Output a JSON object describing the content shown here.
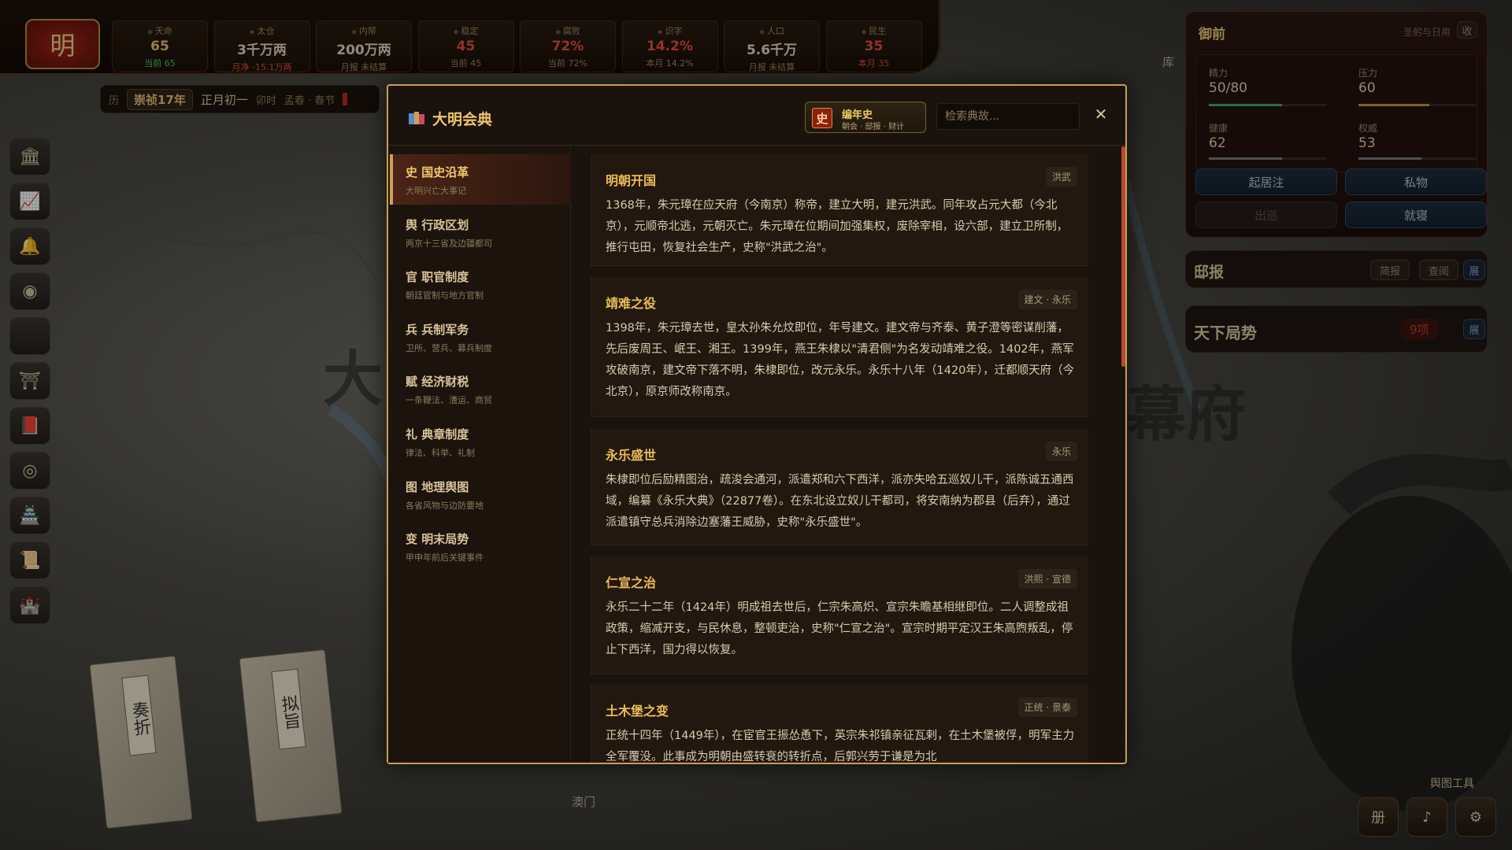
{
  "map": {
    "big_chars": [
      "大",
      "幕府"
    ],
    "small_labels": [
      "库",
      "澳门"
    ]
  },
  "topbar": {
    "emblem": "明",
    "stats": [
      {
        "name": "天命",
        "value": "65",
        "sub": "当前 65",
        "value_color": "#e6c46a",
        "sub_color": "#4ec46a"
      },
      {
        "name": "太仓",
        "value": "3千万两",
        "sub": "月净 -15.1万两",
        "value_color": "#e0d6c0",
        "sub_color": "#e0503a"
      },
      {
        "name": "内帑",
        "value": "200万两",
        "sub": "月报 未结算",
        "value_color": "#e0d6c0",
        "sub_color": "#9a8a6a"
      },
      {
        "name": "稳定",
        "value": "45",
        "sub": "当前 45",
        "value_color": "#e0503a",
        "sub_color": "#9a8a6a"
      },
      {
        "name": "腐败",
        "value": "72%",
        "sub": "当前 72%",
        "value_color": "#e0503a",
        "sub_color": "#9a8a6a"
      },
      {
        "name": "识字",
        "value": "14.2%",
        "sub": "本月 14.2%",
        "value_color": "#e0503a",
        "sub_color": "#9a8a6a"
      },
      {
        "name": "人口",
        "value": "5.6千万",
        "sub": "月报 未结算",
        "value_color": "#e0d6c0",
        "sub_color": "#9a8a6a"
      },
      {
        "name": "民生",
        "value": "35",
        "sub": "本月 35",
        "value_color": "#e0503a",
        "sub_color": "#e0503a"
      }
    ],
    "date": {
      "prefix": "历",
      "era": "崇祯17年",
      "month_day": "正月初一",
      "hour": "卯时",
      "season": "孟春 · 春节"
    }
  },
  "sidebar": {
    "icons": [
      "hall-icon",
      "chart-icon",
      "bell-icon",
      "globe-icon",
      "blank-icon",
      "temple-icon",
      "book-icon",
      "seal-icon",
      "castle-icon",
      "scroll-icon",
      "palace-icon"
    ],
    "glyphs": [
      "🏛",
      "📈",
      "🔔",
      "◉",
      "",
      "⛩",
      "📕",
      "◎",
      "🏯",
      "📜",
      "🏰"
    ]
  },
  "desk_books": [
    {
      "label": "奏折"
    },
    {
      "label": "拟旨"
    }
  ],
  "right_panel": {
    "title": "御前",
    "tag": "圣躬与日用",
    "collapse": "收",
    "stats": [
      {
        "name": "精力",
        "value": "50/80",
        "fill": 0.62,
        "color": "#3aa86a"
      },
      {
        "name": "压力",
        "value": "60",
        "fill": 0.6,
        "color": "#c8962e"
      },
      {
        "name": "健康",
        "value": "62",
        "fill": 0.62,
        "color": "#7a7a7a"
      },
      {
        "name": "权威",
        "value": "53",
        "fill": 0.53,
        "color": "#7a7a7a"
      }
    ],
    "buttons": [
      "起居注",
      "私物",
      "出巡",
      "就寝"
    ],
    "dibao": {
      "title": "邸报",
      "b1": "简报",
      "b2": "查阅",
      "expand": "展"
    },
    "situation": {
      "title": "天下局势",
      "badge": "9项",
      "expand": "展"
    },
    "map_tool": "舆图工具",
    "tools": [
      "册",
      "♪",
      "⚙"
    ]
  },
  "modal": {
    "title": "大明会典",
    "chronicle": {
      "seal": "史",
      "title": "编年史",
      "sub": "朝会 · 邸报 · 财计"
    },
    "search_placeholder": "检索典故...",
    "close": "✕",
    "nav": [
      {
        "title": "史 国史沿革",
        "sub": "大明兴亡大事记"
      },
      {
        "title": "舆 行政区划",
        "sub": "两京十三省及边疆都司"
      },
      {
        "title": "官 职官制度",
        "sub": "朝廷官制与地方官制"
      },
      {
        "title": "兵 兵制军务",
        "sub": "卫所、营兵、募兵制度"
      },
      {
        "title": "赋 经济财税",
        "sub": "一条鞭法、漕运、商贸"
      },
      {
        "title": "礼 典章制度",
        "sub": "律法、科举、礼制"
      },
      {
        "title": "图 地理舆图",
        "sub": "各省风物与边防要地"
      },
      {
        "title": "变 明末局势",
        "sub": "甲申年前后关键事件"
      }
    ],
    "entries": [
      {
        "title": "明朝开国",
        "tag": "洪武",
        "body": "1368年，朱元璋在应天府（今南京）称帝，建立大明，建元洪武。同年攻占元大都（今北京），元顺帝北逃，元朝灭亡。朱元璋在位期间加强集权，废除宰相，设六部，建立卫所制，推行屯田，恢复社会生产，史称\"洪武之治\"。"
      },
      {
        "title": "靖难之役",
        "tag": "建文 · 永乐",
        "body": "1398年，朱元璋去世，皇太孙朱允炆即位，年号建文。建文帝与齐泰、黄子澄等密谋削藩，先后废周王、岷王、湘王。1399年，燕王朱棣以\"清君侧\"为名发动靖难之役。1402年，燕军攻破南京，建文帝下落不明，朱棣即位，改元永乐。永乐十八年（1420年），迁都顺天府（今北京），原京师改称南京。"
      },
      {
        "title": "永乐盛世",
        "tag": "永乐",
        "body": "朱棣即位后励精图治，疏浚会通河，派遣郑和六下西洋，派亦失哈五巡奴儿干，派陈诚五通西域，编纂《永乐大典》（22877卷）。在东北设立奴儿干都司，将安南纳为郡县（后弃），通过派遣镇守总兵消除边塞藩王威胁，史称\"永乐盛世\"。"
      },
      {
        "title": "仁宣之治",
        "tag": "洪熙 · 宣德",
        "body": "永乐二十二年（1424年）明成祖去世后，仁宗朱高炽、宣宗朱瞻基相继即位。二人调整成祖政策，缩减开支，与民休息，整顿吏治，史称\"仁宣之治\"。宣宗时期平定汉王朱高煦叛乱，停止下西洋，国力得以恢复。"
      },
      {
        "title": "土木堡之变",
        "tag": "正统 · 景泰",
        "body": "正统十四年（1449年），在宦官王振怂恿下，英宗朱祁镇亲征瓦剌，在土木堡被俘，明军主力全军覆没。此事成为明朝由盛转衰的转折点，后郭兴劳于谦是为北"
      }
    ]
  }
}
